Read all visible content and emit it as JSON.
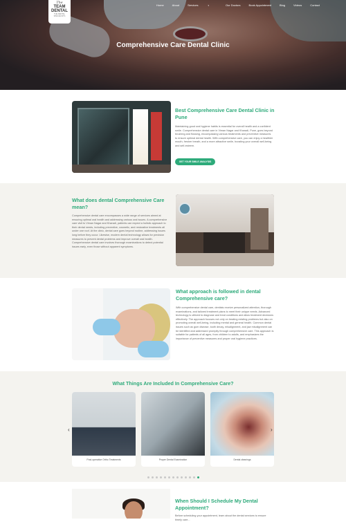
{
  "logo": {
    "line1": "The",
    "line2": "TEAM",
    "line3": "DENTAL",
    "tagline": "THE DENTAL SPECIALISTS"
  },
  "nav": {
    "items": [
      "Home",
      "About",
      "Services",
      "Our Doctors",
      "Book Appointment",
      "Blog",
      "Videos",
      "Contact"
    ],
    "active_index": 2
  },
  "hero": {
    "title": "Comprehensive Care Dental Clinic"
  },
  "section1": {
    "heading": "Best Comprehensive Care Dental Clinic in Pune",
    "body": "Maintaining good oral hygiene habits is essential for overall health and a confident smile. Comprehensive dental care in Viman Nagar and Kharadi, Pune, goes beyond brushing and flossing, encompassing various treatments and preventive measures to ensure optimal dental health. With comprehensive care, you can enjoy a healthier mouth, fresher breath, and a more attractive smile, boosting your overall well-being and self-esteem.",
    "button": "GET YOUR SMILE ANALYSIS"
  },
  "section2": {
    "heading": "What does dental Comprehensive Care mean?",
    "body": "Comprehensive dental care encompasses a wide range of services aimed at ensuring optimal oral health and addressing various oral issues. A comprehensive care visit to Viman Nagar and Kharadi, patients can expect a holistic approach to their dental needs, including preventive, cosmetic, and restorative treatments all under one roof. At the clinic, dental care goes beyond routine, addressing issues long before they occur. Likewise, modern dental technology allows for precision measures to prevent dental problems and improve overall oral health. Comprehensive dental care involves thorough examinations to detect potential issues early, even those without apparent symptoms."
  },
  "section3": {
    "heading": "What approach is followed in dental Comprehensive care?",
    "body": "With comprehensive dental care, dentists receive personalized attention, thorough examinations, and tailored treatment plans to meet their unique needs. Advanced technology is utilized to diagnose and treat conditions and allow treatment decisions effectively. The approach focuses not only on treating existing problems but also on promoting overall well-being, including mental and general health. Common dental issues such as gum disease, tooth decay, misalignment, and jaw misalignment can be identified and addressed promptly through comprehensive care. This approach is suitable for patients of all ages, from children to adults, and emphasizes the importance of preventive measures and proper oral hygiene practices."
  },
  "section4": {
    "heading": "What Things Are Included In Comprehensive Care?",
    "cards": [
      {
        "caption": "Post-operative Ortho Treatments"
      },
      {
        "caption": "Proper Dental Examination"
      },
      {
        "caption": "Dental cleanings"
      }
    ],
    "pagination_total": 13,
    "pagination_active": 12
  },
  "section5": {
    "heading": "When Should I Schedule My Dental Appointment?",
    "body": "Before scheduling your appointment, learn about the dental services to ensure timely care..."
  }
}
